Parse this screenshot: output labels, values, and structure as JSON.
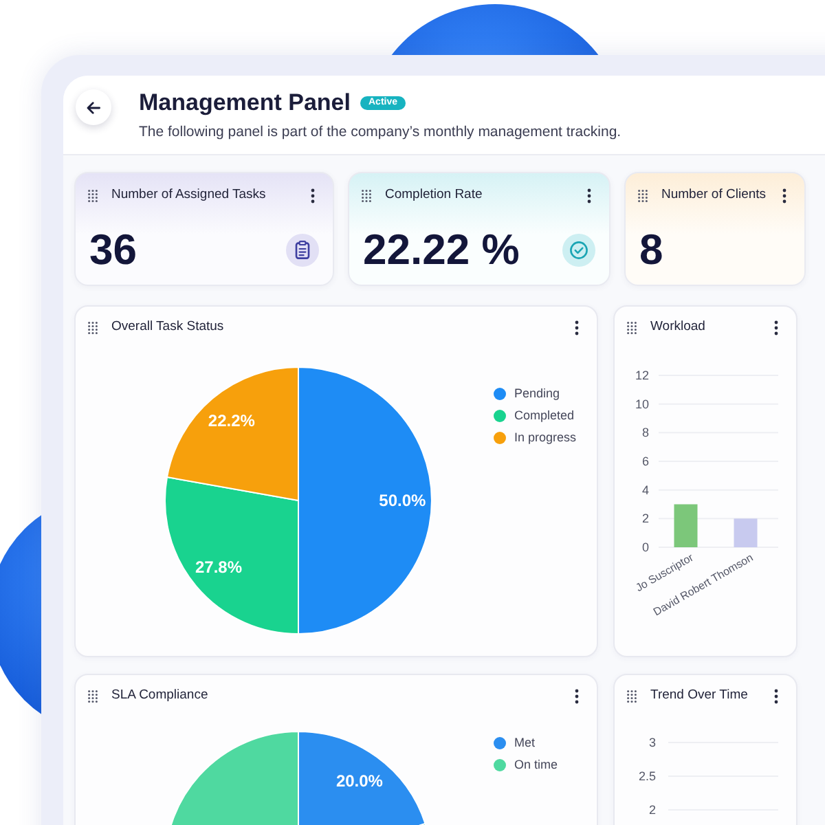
{
  "header": {
    "title": "Management Panel",
    "status": "Active",
    "subtitle": "The following panel is part of the company’s monthly management tracking."
  },
  "stats": [
    {
      "title": "Number of Assigned Tasks",
      "value": "36"
    },
    {
      "title": "Completion Rate",
      "value": "22.22 %"
    },
    {
      "title": "Number of Clients",
      "value": "8"
    }
  ],
  "panels": [
    {
      "title": "Overall Task Status",
      "chart_data": {
        "type": "pie",
        "categories": [
          "Pending",
          "Completed",
          "In progress"
        ],
        "values": [
          50.0,
          27.8,
          22.2
        ],
        "colors": [
          "#1e8cf5",
          "#19d38f",
          "#f7a00c"
        ],
        "value_labels": [
          "50.0%",
          "27.8%",
          "22.2%"
        ],
        "legend": "right"
      }
    },
    {
      "title": "Workload",
      "chart_data": {
        "type": "bar",
        "categories": [
          "Jo Suscriptor",
          "David Robert Thomson"
        ],
        "values": [
          3,
          2
        ],
        "colors": [
          "#7cc77a",
          "#c8caef"
        ],
        "ylim": [
          0,
          12
        ],
        "yticks": [
          0,
          2,
          4,
          6,
          8,
          10,
          12
        ],
        "grid": true
      }
    },
    {
      "title": "SLA Compliance",
      "chart_data": {
        "type": "pie",
        "categories": [
          "Met",
          "On time"
        ],
        "values": [
          20,
          80
        ],
        "colors": [
          "#2b8ef0",
          "#4fd9a0"
        ],
        "value_labels": [
          "20.0%",
          null
        ],
        "legend": "right"
      }
    },
    {
      "title": "Trend Over Time",
      "y_axis_labels": [
        "3",
        "2.5",
        "2"
      ]
    }
  ]
}
